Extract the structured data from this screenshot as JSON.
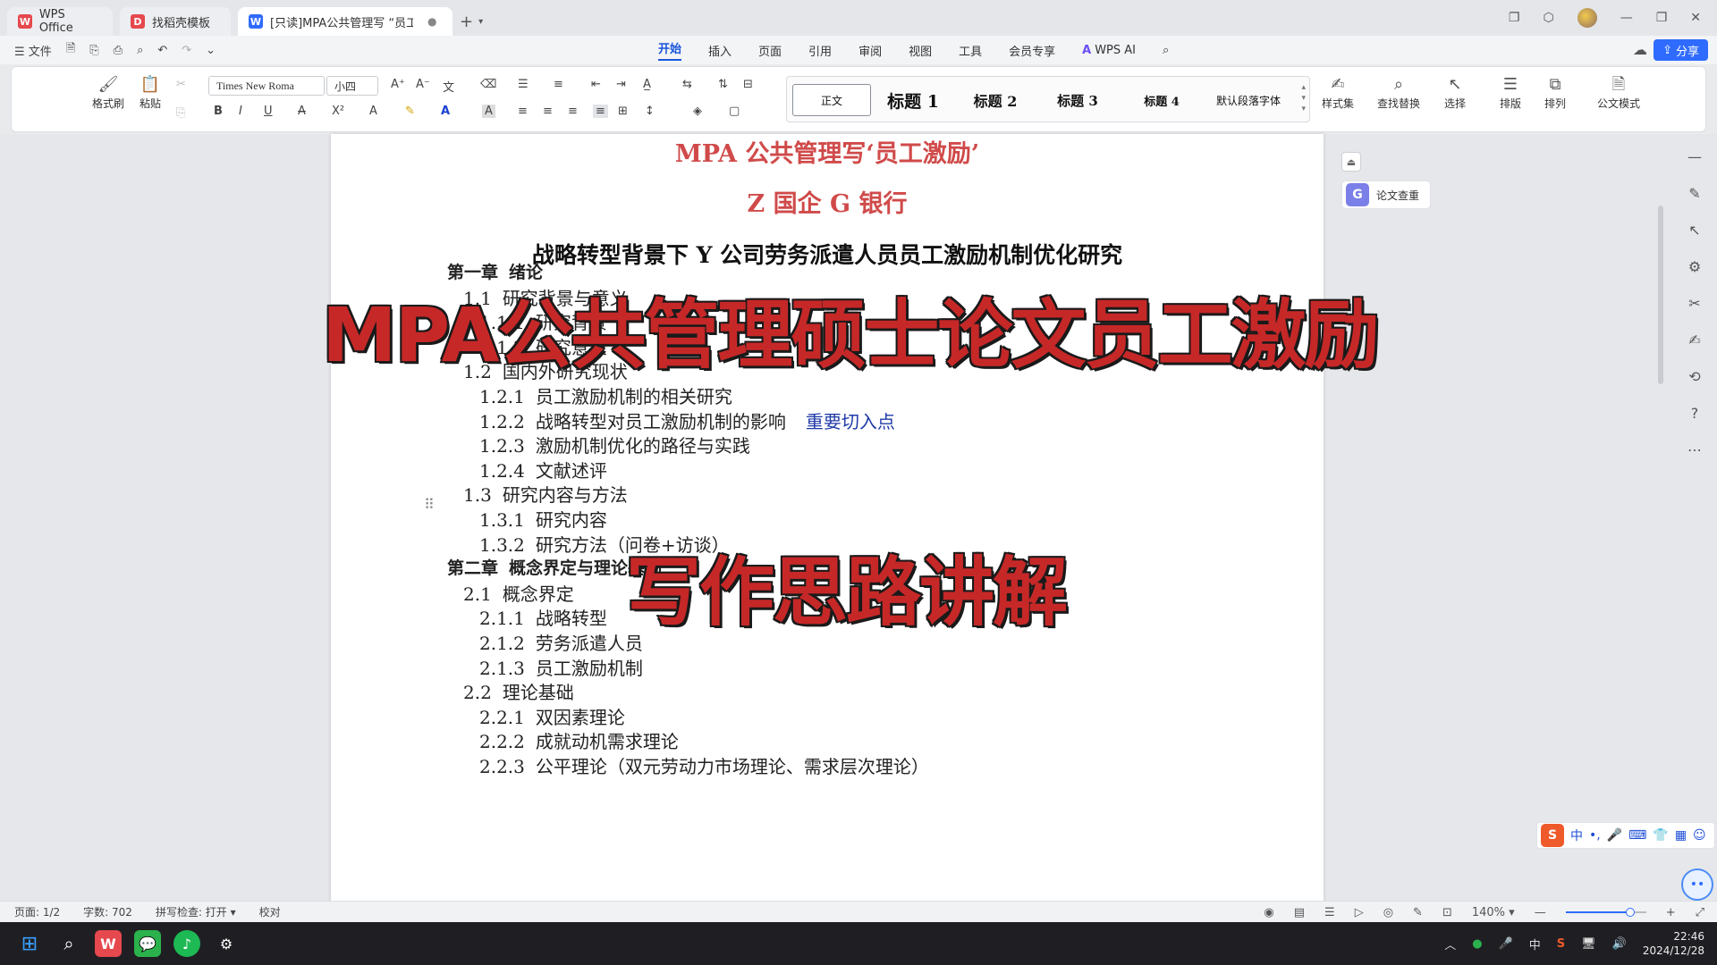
{
  "tabs": [
    {
      "label": "WPS Office",
      "logo": "W",
      "logo_color": "#e5484d"
    },
    {
      "label": "找稻壳模板",
      "logo": "D",
      "logo_color": "#e5484d"
    },
    {
      "label": "[只读]MPA公共管理写 “员工",
      "logo": "W",
      "logo_color": "#2f6bff"
    }
  ],
  "menu": {
    "file": "文件",
    "tabs": [
      "开始",
      "插入",
      "页面",
      "引用",
      "审阅",
      "视图",
      "工具",
      "会员专享"
    ],
    "ai": "WPS AI",
    "share": "分享"
  },
  "ribbon": {
    "format_painter": "格式刷",
    "paste": "粘贴",
    "font_name": "Times New Roma",
    "font_size": "小四",
    "styles": [
      "正文",
      "标题 1",
      "标题 2",
      "标题 3",
      "标题 4",
      "默认段落字体"
    ],
    "style_set": "样式集",
    "find_replace": "查找替换",
    "select": "选择",
    "layout": "排版",
    "arrange": "排列",
    "doc_mode": "公文模式"
  },
  "document": {
    "title_line1": "MPA 公共管理写‘员工激励’",
    "title_line2": "Z 国企 G 银行",
    "thesis_title": "战略转型背景下 Y 公司劳务派遣人员员工激励机制优化研究",
    "toc": [
      {
        "num": "第一章",
        "text": "绪论",
        "level": 0
      },
      {
        "num": "1.1",
        "text": "研究背景与意义",
        "level": 1
      },
      {
        "num": "1.1.1",
        "text": "研究背景",
        "level": 2
      },
      {
        "num": "1.1.2",
        "text": "研究意义",
        "level": 2
      },
      {
        "num": "1.2",
        "text": "国内外研究现状",
        "level": 1
      },
      {
        "num": "1.2.1",
        "text": "员工激励机制的相关研究",
        "level": 2
      },
      {
        "num": "1.2.2",
        "text": "战略转型对员工激励机制的影响",
        "level": 2,
        "hint": "重要切入点"
      },
      {
        "num": "1.2.3",
        "text": "激励机制优化的路径与实践",
        "level": 2
      },
      {
        "num": "1.2.4",
        "text": "文献述评",
        "level": 2
      },
      {
        "num": "1.3",
        "text": "研究内容与方法",
        "level": 1
      },
      {
        "num": "1.3.1",
        "text": "研究内容",
        "level": 2
      },
      {
        "num": "1.3.2",
        "text": "研究方法（问卷+访谈）",
        "level": 2
      },
      {
        "num": "第二章",
        "text": "概念界定与理论基础",
        "level": 0
      },
      {
        "num": "2.1",
        "text": "概念界定",
        "level": 1
      },
      {
        "num": "2.1.1",
        "text": "战略转型",
        "level": 2
      },
      {
        "num": "2.1.2",
        "text": "劳务派遣人员",
        "level": 2
      },
      {
        "num": "2.1.3",
        "text": "员工激励机制",
        "level": 2
      },
      {
        "num": "2.2",
        "text": "理论基础",
        "level": 1
      },
      {
        "num": "2.2.1",
        "text": "双因素理论",
        "level": 2
      },
      {
        "num": "2.2.2",
        "text": "成就动机需求理论",
        "level": 2
      },
      {
        "num": "2.2.3",
        "text": "公平理论（双元劳动力市场理论、需求层次理论）",
        "level": 2
      }
    ]
  },
  "overlay": {
    "headline": "MPA公共管理硕士论文员工激励",
    "subline": "写作思路讲解"
  },
  "side_panel": {
    "paper_check": "论文查重"
  },
  "ime": {
    "mode": "中"
  },
  "statusbar": {
    "page": "页面: 1/2",
    "words": "字数: 702",
    "spell": "拼写检查: 打开",
    "proof": "校对",
    "zoom": "140%",
    "zoom_level": 0.8
  },
  "taskbar": {
    "ime": "中",
    "time": "22:46",
    "date": "2024/12/28"
  }
}
